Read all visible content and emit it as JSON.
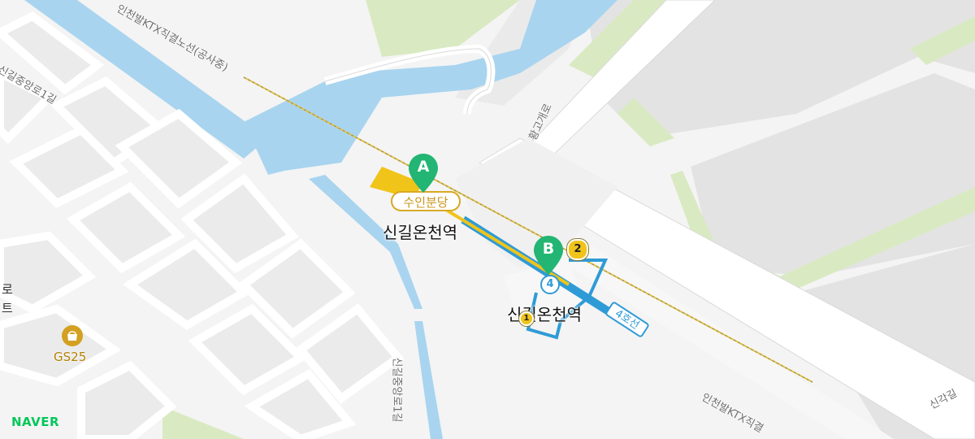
{
  "map": {
    "provider_logo": "NAVER",
    "colors": {
      "water": "#a8d4ef",
      "park": "#d9eac2",
      "road": "#ffffff",
      "block": "#ebebeb",
      "line4": "#2f9bd6",
      "shinbundang": "#f0c419",
      "marker": "#22b573"
    },
    "stations": [
      {
        "name": "신길온천역",
        "line_badge": "수인분당",
        "marker": "A"
      },
      {
        "name": "신길온천역",
        "line_badge": "4호선",
        "line_number": "4",
        "marker": "B"
      }
    ],
    "exits": [
      "2",
      "1"
    ],
    "roads": {
      "sinsingjungang_1gil_top": "신길중앙로1길",
      "sinsingjungang_1gil_bottom": "신길중앙로1길",
      "hwanggogae_ro": "황고개로",
      "rail_top": "인천발KTX직결노선(공사중)",
      "rail_bottom": "인천발KTX직결",
      "singak_gil": "신각길"
    },
    "poi": {
      "name": "GS25",
      "icon": "convenience-store-icon"
    },
    "edge_text": [
      "로",
      "트"
    ]
  }
}
